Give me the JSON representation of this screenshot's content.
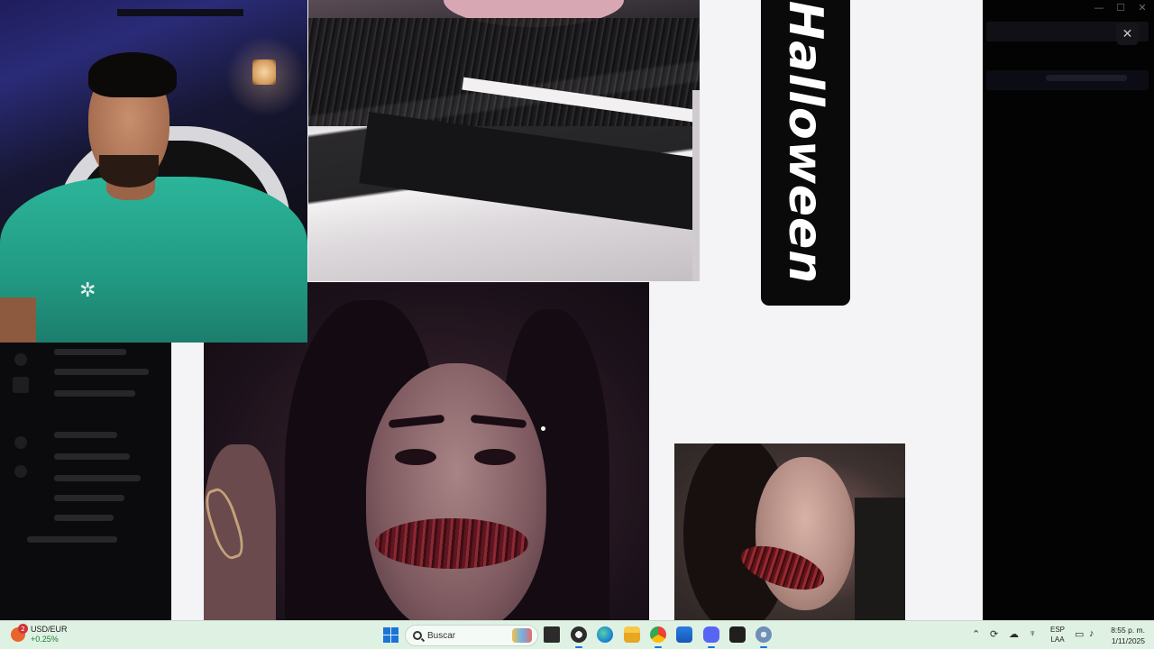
{
  "viewer": {
    "close_label": "✕",
    "poster_text": "Halloween"
  },
  "widget": {
    "title": "USD/EUR",
    "change": "+0.25%",
    "badge": "2"
  },
  "taskbar": {
    "search_placeholder": "Buscar",
    "apps": [
      "file-explorer",
      "obs-studio",
      "edge",
      "files",
      "chrome",
      "store",
      "discord",
      "epic-games",
      "settings"
    ],
    "language_line1": "ESP",
    "language_line2": "LAA",
    "time": "8:55 p. m.",
    "date": "1/11/2025"
  },
  "colors": {
    "taskbar_bg": "#dff1e3",
    "viewer_bg": "#f4f3f5",
    "accent": "#1a73d9"
  }
}
